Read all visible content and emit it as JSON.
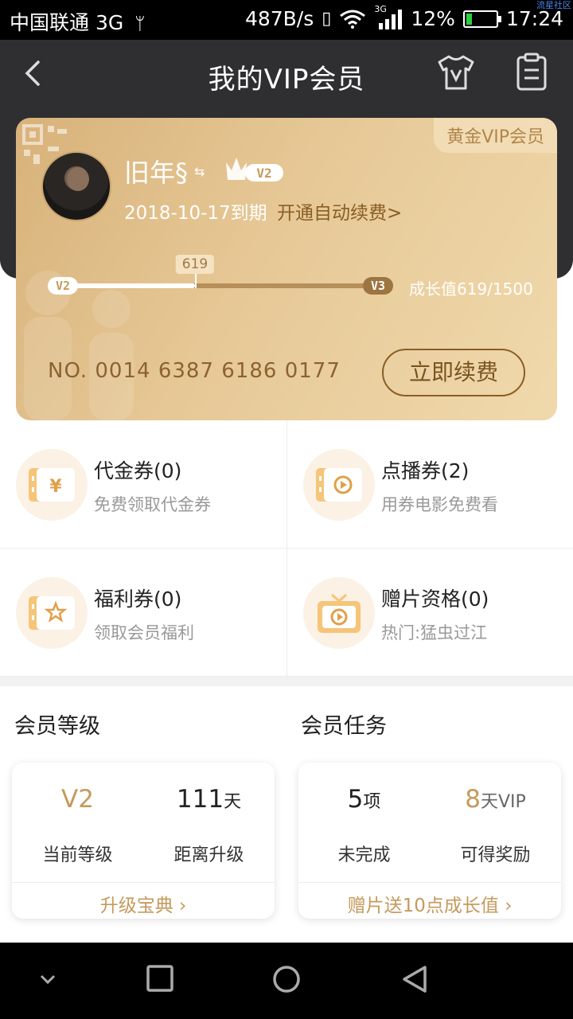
{
  "status_bar": {
    "carrier": "中国联通 3G",
    "speed": "487B/s",
    "network": "3G",
    "battery": "12%",
    "time": "17:24",
    "watermark": "流星社区"
  },
  "header": {
    "title": "我的VIP会员"
  },
  "card": {
    "badge": "黄金VIP会员",
    "username": "旧年§",
    "level_badge": "V2",
    "expiry": "2018-10-17到期",
    "auto_renew": "开通自动续费>",
    "progress": {
      "current_level": "V2",
      "next_level": "V3",
      "value": 619,
      "max": 1500,
      "marker_label": "619",
      "growth_text": "成长值619/1500"
    },
    "card_number": "NO. 0014 6387 6186 0177",
    "renew_button": "立即续费"
  },
  "coupons": [
    {
      "title": "代金券(0)",
      "subtitle": "免费领取代金券",
      "icon": "yuan-ticket-icon"
    },
    {
      "title": "点播券(2)",
      "subtitle": "用券电影免费看",
      "icon": "play-ticket-icon"
    },
    {
      "title": "福利券(0)",
      "subtitle": "领取会员福利",
      "icon": "star-ticket-icon"
    },
    {
      "title": "赠片资格(0)",
      "subtitle": "热门:猛虫过江",
      "icon": "gift-play-icon"
    }
  ],
  "level_section": {
    "title": "会员等级",
    "current_value": "V2",
    "current_label": "当前等级",
    "days_value": "111",
    "days_unit": "天",
    "days_label": "距离升级",
    "link": "升级宝典"
  },
  "task_section": {
    "title": "会员任务",
    "pending_value": "5",
    "pending_unit": "项",
    "pending_label": "未完成",
    "reward_value": "8",
    "reward_unit": "天VIP",
    "reward_label": "可得奖励",
    "link": "赠片送10点成长值"
  },
  "colors": {
    "gold": "#c59a5d",
    "card_start": "#d8b27a",
    "card_end": "#f0d9ac",
    "header_bg": "#2f2f31"
  }
}
